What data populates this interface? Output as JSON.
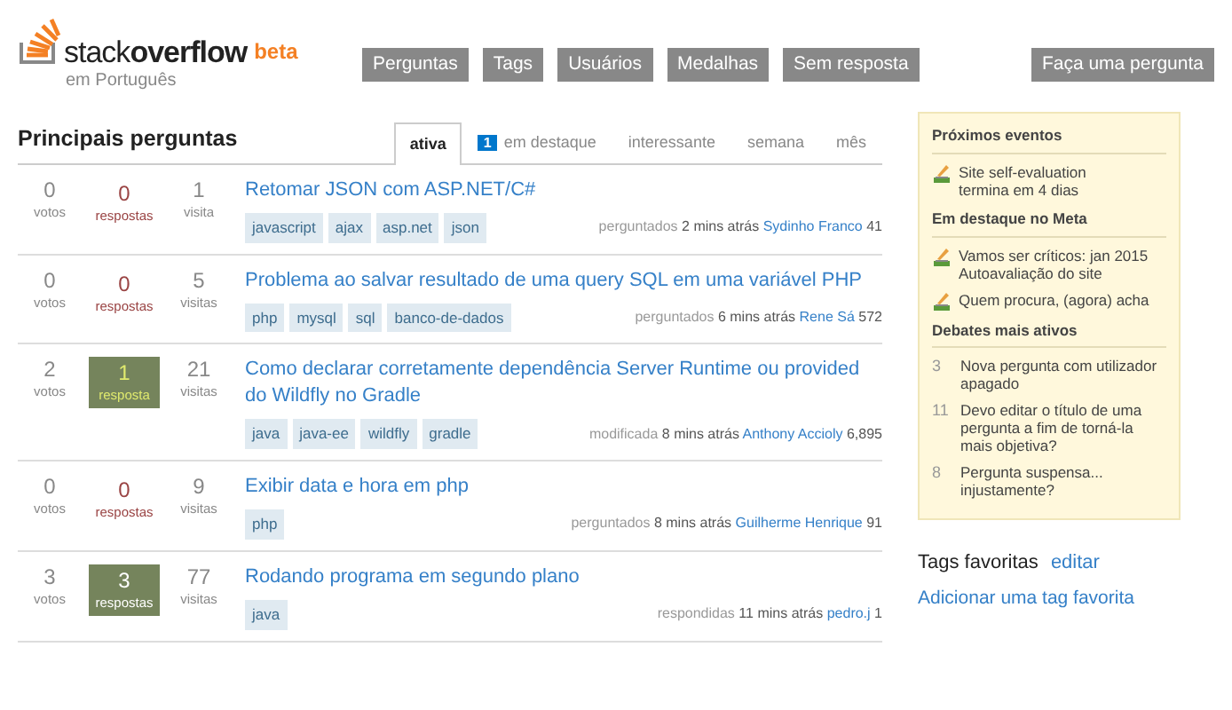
{
  "logo": {
    "word_light": "stack",
    "word_bold": "overflow",
    "badge": "beta",
    "subtitle": "em Português"
  },
  "nav": [
    "Perguntas",
    "Tags",
    "Usuários",
    "Medalhas",
    "Sem resposta"
  ],
  "ask_button": "Faça uma pergunta",
  "heading": "Principais perguntas",
  "tabs": [
    {
      "label": "ativa",
      "selected": true
    },
    {
      "label": "em destaque",
      "count": "1",
      "selected": false
    },
    {
      "label": "interessante",
      "selected": false
    },
    {
      "label": "semana",
      "selected": false
    },
    {
      "label": "mês",
      "selected": false
    }
  ],
  "questions": [
    {
      "votes": "0",
      "votes_label": "votos",
      "answers": "0",
      "answers_label": "respostas",
      "answered": false,
      "views": "1",
      "views_label": "visita",
      "title": "Retomar JSON com ASP.NET/C#",
      "tags": [
        "javascript",
        "ajax",
        "asp.net",
        "json"
      ],
      "action": "perguntados",
      "time": "2 mins atrás",
      "user": "Sydinho Franco",
      "rep": "41"
    },
    {
      "votes": "0",
      "votes_label": "votos",
      "answers": "0",
      "answers_label": "respostas",
      "answered": false,
      "views": "5",
      "views_label": "visitas",
      "title": "Problema ao salvar resultado de uma query SQL em uma variável PHP",
      "tags": [
        "php",
        "mysql",
        "sql",
        "banco-de-dados"
      ],
      "action": "perguntados",
      "time": "6 mins atrás",
      "user": "Rene Sá",
      "rep": "572"
    },
    {
      "votes": "2",
      "votes_label": "votos",
      "answers": "1",
      "answers_label": "resposta",
      "answered": true,
      "accepted": true,
      "views": "21",
      "views_label": "visitas",
      "title": "Como declarar corretamente dependência Server Runtime ou provided do Wildfly no Gradle",
      "tags": [
        "java",
        "java-ee",
        "wildfly",
        "gradle"
      ],
      "action": "modificada",
      "time": "8 mins atrás",
      "user": "Anthony Accioly",
      "rep": "6,895"
    },
    {
      "votes": "0",
      "votes_label": "votos",
      "answers": "0",
      "answers_label": "respostas",
      "answered": false,
      "views": "9",
      "views_label": "visitas",
      "title": "Exibir data e hora em php",
      "tags": [
        "php"
      ],
      "action": "perguntados",
      "time": "8 mins atrás",
      "user": "Guilherme Henrique",
      "rep": "91"
    },
    {
      "votes": "3",
      "votes_label": "votos",
      "answers": "3",
      "answers_label": "respostas",
      "answered": true,
      "accepted": false,
      "views": "77",
      "views_label": "visitas",
      "title": "Rodando programa em segundo plano",
      "tags": [
        "java"
      ],
      "action": "respondidas",
      "time": "11 mins atrás",
      "user": "pedro.j",
      "rep": "1"
    }
  ],
  "sidebar": {
    "sections": [
      {
        "title": "Próximos eventos",
        "kind": "icon",
        "items": [
          {
            "lines": [
              "Site self-evaluation",
              "termina em 4 dias"
            ]
          }
        ]
      },
      {
        "title": "Em destaque no Meta",
        "kind": "icon",
        "items": [
          {
            "lines": [
              "Vamos ser críticos: jan 2015",
              "Autoavaliação do site"
            ]
          },
          {
            "lines": [
              "Quem procura, (agora) acha"
            ]
          }
        ]
      },
      {
        "title": "Debates mais ativos",
        "kind": "count",
        "items": [
          {
            "count": "3",
            "lines": [
              "Nova pergunta com utilizador apagado"
            ]
          },
          {
            "count": "11",
            "lines": [
              "Devo editar o título de uma pergunta a fim de torná-la mais objetiva?"
            ]
          },
          {
            "count": "8",
            "lines": [
              "Pergunta suspensa... injustamente?"
            ]
          }
        ]
      }
    ]
  },
  "favorites": {
    "title": "Tags favoritas",
    "edit": "editar",
    "add": "Adicionar uma tag favorita"
  }
}
